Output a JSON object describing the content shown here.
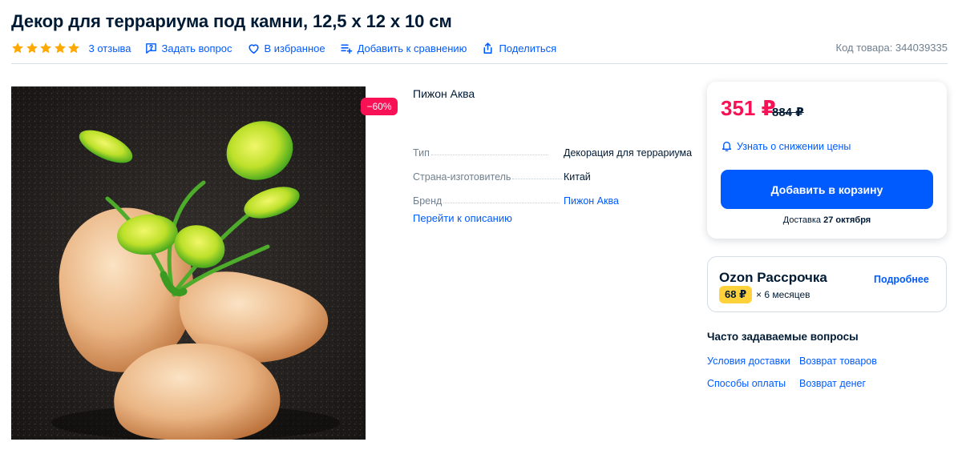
{
  "product": {
    "title": "Декор для террариума под камни, 12,5 х 12 х 10 см",
    "rating_stars": 5,
    "star_color": "#ffa800",
    "reviews": "3 отзыва",
    "ask_question": "Задать вопрос",
    "favorites": "В избранное",
    "compare": "Добавить к сравнению",
    "share": "Поделиться",
    "sku": "Код товара: 344039335"
  },
  "gallery": {
    "discount_badge": "−60%",
    "badge_color": "#f91155"
  },
  "details": {
    "brand": "Пижон Аква",
    "specs": [
      {
        "key": "Тип",
        "value": "Декорация для террариума"
      },
      {
        "key": "Страна-изготовитель",
        "value": "Китай"
      },
      {
        "key": "Бренд",
        "value": "Пижон Аква"
      }
    ],
    "to_description": "Перейти к описанию"
  },
  "price_card": {
    "price": "351 ₽",
    "old_price": "884 ₽",
    "price_color": "#f91155",
    "notify": "Узнать о снижении цены",
    "add_to_cart": "Добавить в корзину",
    "accent_color": "#005bff",
    "delivery_label": "Доставка",
    "delivery_date": "27 октября"
  },
  "installment": {
    "title": "Ozon Рассрочка",
    "more": "Подробнее",
    "monthly": "68 ₽",
    "term": "× 6 месяцев"
  },
  "faq": {
    "title": "Часто задаваемые вопросы",
    "links": [
      "Условия доставки",
      "Возврат товаров",
      "Способы оплаты",
      "Возврат денег"
    ]
  }
}
